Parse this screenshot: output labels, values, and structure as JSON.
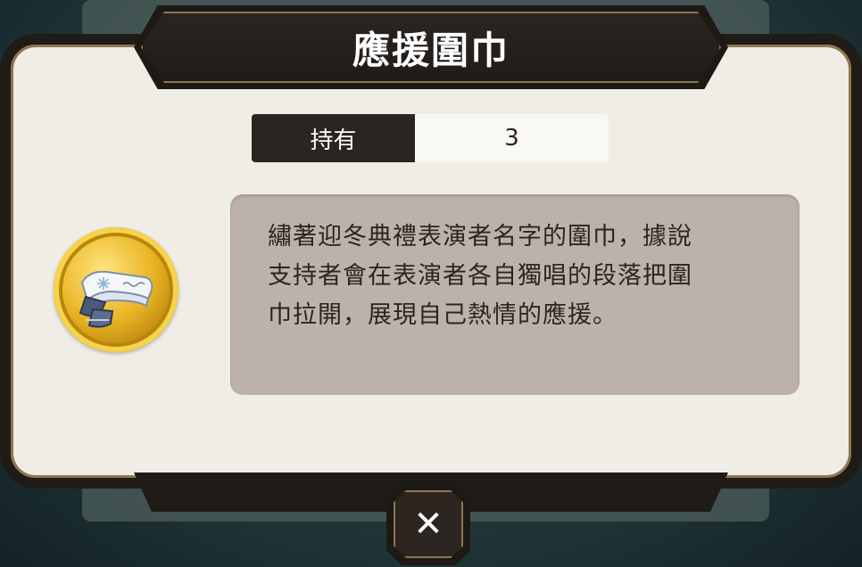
{
  "dialog": {
    "title": "應援圍巾",
    "holding_label": "持有",
    "holding_value": "3",
    "description_lines": [
      "繡著迎冬典禮表演者名字的圍巾，據說",
      "支持者會在表演者各自獨唱的段落把圍",
      "巾拉開，展現自己熱情的應援。"
    ],
    "item_icon": "scarf-coin-icon",
    "close_icon": "close-x-icon"
  },
  "colors": {
    "panel": "#f0ede6",
    "frame": "#1f1b17",
    "gold_trim": "#8f7650",
    "description_bg": "#bdb2a9",
    "coin_gold": "#e9b525"
  }
}
